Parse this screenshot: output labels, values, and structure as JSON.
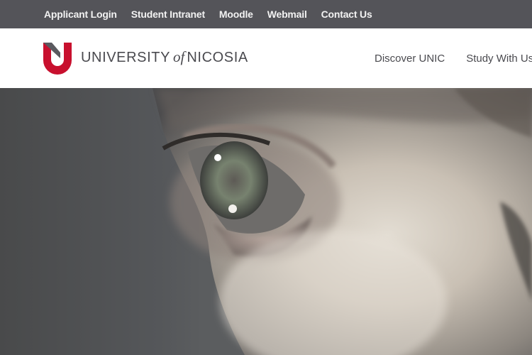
{
  "topbar": {
    "links": [
      {
        "label": "Applicant Login"
      },
      {
        "label": "Student Intranet"
      },
      {
        "label": "Moodle"
      },
      {
        "label": "Webmail"
      },
      {
        "label": "Contact Us"
      }
    ]
  },
  "header": {
    "logo": {
      "word_main": "UNIVERSITY",
      "word_of": "of",
      "word_end": "NICOSIA",
      "brand_red": "#c8102e",
      "brand_gray": "#5a5a5f"
    },
    "nav": [
      {
        "label": "Discover UNIC"
      },
      {
        "label": "Study With Us"
      }
    ]
  },
  "hero": {
    "image": "close-up-eye-photo"
  }
}
